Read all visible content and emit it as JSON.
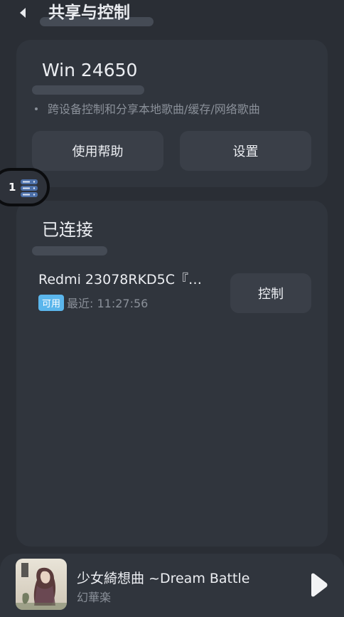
{
  "header": {
    "title": "共享与控制",
    "back_icon": "back-arrow-icon"
  },
  "host_card": {
    "name": "Win 24650",
    "description": "跨设备控制和分享本地歌曲/缓存/网络歌曲",
    "help_label": "使用帮助",
    "settings_label": "设置"
  },
  "side_indicator": {
    "count": "1",
    "icon": "server-list-icon"
  },
  "connected": {
    "heading": "已连接",
    "devices": [
      {
        "name": "Redmi 23078RKD5C『…",
        "status_badge": "可用",
        "last_seen": "最近: 11:27:56",
        "control_label": "控制"
      }
    ]
  },
  "player": {
    "song_title": "少女綺想曲 ~Dream Battle",
    "artist": "幻華楽",
    "cover_icon": "album-cover",
    "play_icon": "play-icon"
  },
  "colors": {
    "background": "#2a2e35",
    "card": "#30353d",
    "button": "#3a3f48",
    "accent_badge": "#5bb6ec",
    "muted_text": "#8a9099"
  }
}
